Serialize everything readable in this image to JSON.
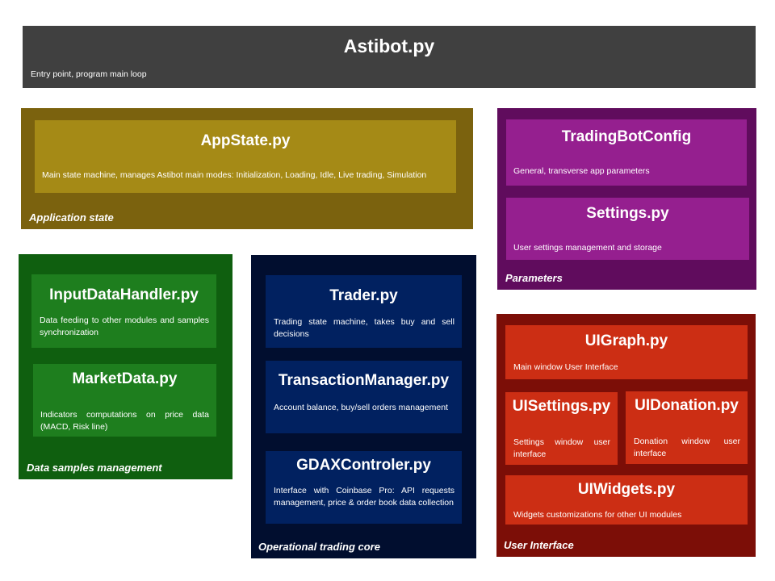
{
  "colors": {
    "main_bg": "#404040",
    "app_state_outer": "#7b620e",
    "app_state_inner": "#a58a16",
    "parameters_outer": "#600c5d",
    "parameters_inner": "#951f8f",
    "data_outer": "#0f5f0f",
    "data_inner": "#1e7e1e",
    "core_outer": "#010e2f",
    "core_inner": "#012160",
    "ui_outer": "#7c0e07",
    "ui_inner": "#cc2e14"
  },
  "main": {
    "title": "Astibot.py",
    "desc": "Entry point, program main loop"
  },
  "groups": {
    "app_state": {
      "label": "Application state",
      "boxes": {
        "appstate": {
          "title": "AppState.py",
          "desc": "Main state machine, manages Astibot main modes: Initialization, Loading, Idle, Live trading, Simulation"
        }
      }
    },
    "parameters": {
      "label": "Parameters",
      "boxes": {
        "config": {
          "title": "TradingBotConfig",
          "desc": "General, transverse app parameters"
        },
        "settings": {
          "title": "Settings.py",
          "desc": "User settings management and storage"
        }
      }
    },
    "data": {
      "label": "Data samples management",
      "boxes": {
        "input": {
          "title": "InputDataHandler.py",
          "desc": "Data feeding to other modules and samples synchronization"
        },
        "market": {
          "title": "MarketData.py",
          "desc": "Indicators computations on price data (MACD, Risk line)"
        }
      }
    },
    "core": {
      "label": "Operational trading core",
      "boxes": {
        "trader": {
          "title": "Trader.py",
          "desc": "Trading state machine,  takes buy and sell decisions"
        },
        "transaction": {
          "title": "TransactionManager.py",
          "desc": "Account balance, buy/sell orders management"
        },
        "gdax": {
          "title": "GDAXControler.py",
          "desc": "Interface with Coinbase Pro: API requests management, price  & order book data collection"
        }
      }
    },
    "ui": {
      "label": "User Interface",
      "boxes": {
        "graph": {
          "title": "UIGraph.py",
          "desc": "Main window User Interface"
        },
        "settings": {
          "title": "UISettings.py",
          "desc": "Settings window user interface"
        },
        "donation": {
          "title": "UIDonation.py",
          "desc": "Donation window user interface"
        },
        "widgets": {
          "title": "UIWidgets.py",
          "desc": "Widgets customizations for other UI modules"
        }
      }
    }
  }
}
